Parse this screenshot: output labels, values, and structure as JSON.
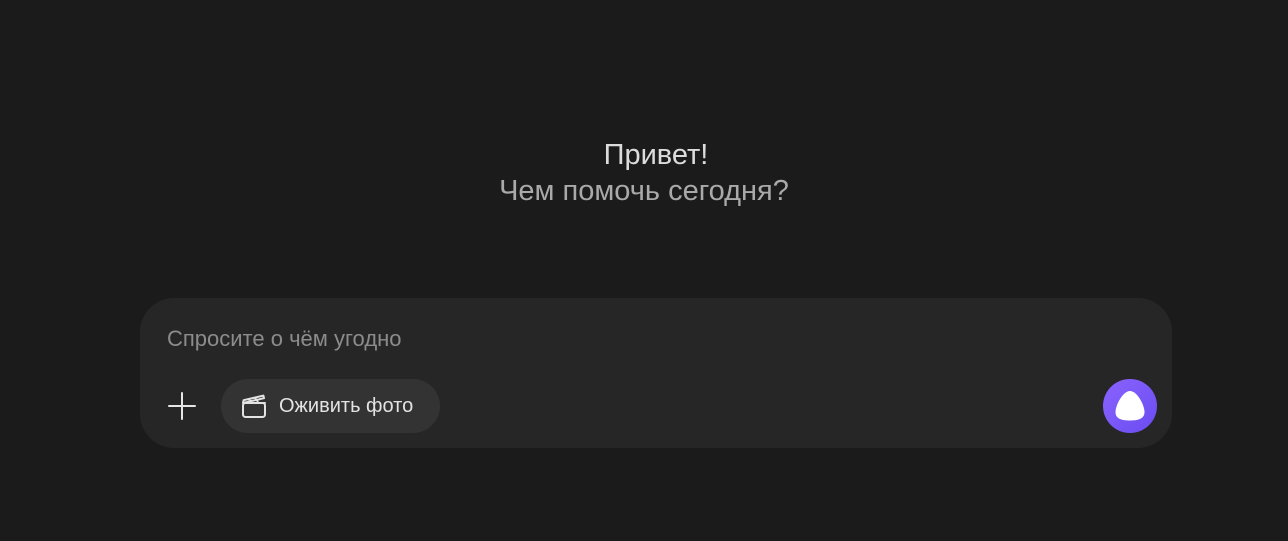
{
  "greeting": {
    "title": "Привет!",
    "subtitle": "Чем помочь сегодня?"
  },
  "composer": {
    "value": "",
    "placeholder": "Спросите о чём угодно",
    "add_icon": "plus-icon",
    "chip": {
      "icon": "clapperboard-icon",
      "label": "Оживить фото"
    },
    "voice_icon": "alice-icon"
  },
  "colors": {
    "background": "#1b1b1b",
    "composer_background": "#262626",
    "chip_background": "#333333",
    "accent": "#7b5cf5"
  }
}
